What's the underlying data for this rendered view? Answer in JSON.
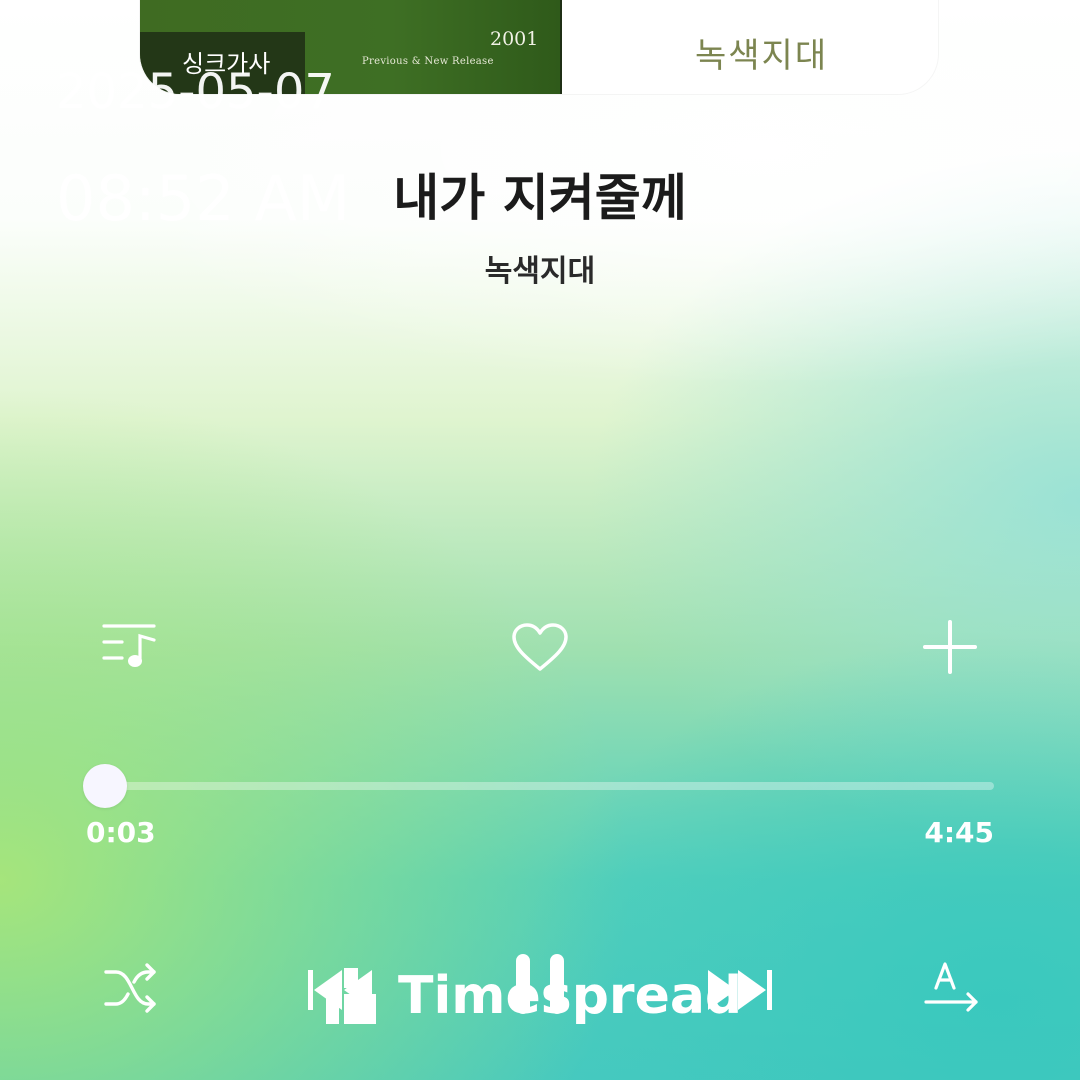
{
  "status_overlay": {
    "date": "2025-05-07",
    "time": "08:52 AM"
  },
  "album_art": {
    "year": "2001",
    "subtitle": "Previous & New Release",
    "cover_title": "녹색지대",
    "sync_lyrics_label": "싱크가사"
  },
  "song": {
    "title": "내가 지켜줄께",
    "artist": "녹색지대"
  },
  "actions": {
    "icons": [
      "playlist-icon",
      "heart-icon",
      "add-icon"
    ]
  },
  "playback": {
    "elapsed": "0:03",
    "total": "4:45",
    "progress_fraction": 0.0105
  },
  "controls": {
    "icons": [
      "shuffle-icon",
      "previous-icon",
      "pause-icon",
      "next-icon",
      "translate-icon"
    ]
  },
  "watermark": {
    "text": "Timespread"
  },
  "colors": {
    "accent": "#ffffff",
    "title_text": "#1b1b1b",
    "gradient_teal": "#47c9bf",
    "gradient_green": "#aae678"
  }
}
